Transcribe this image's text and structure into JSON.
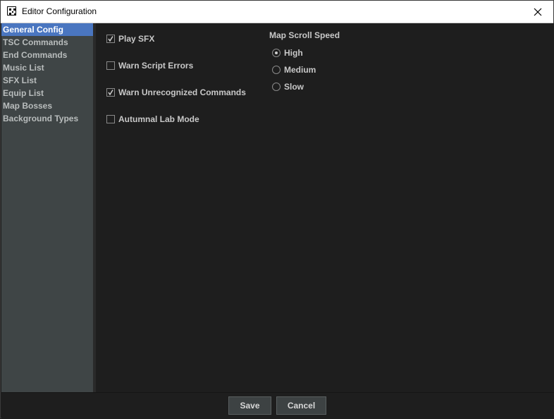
{
  "window": {
    "title": "Editor Configuration",
    "app_icon": "app-qr-icon",
    "close_icon": "close-icon"
  },
  "sidebar": {
    "items": [
      {
        "label": "General Config",
        "selected": true
      },
      {
        "label": "TSC Commands",
        "selected": false
      },
      {
        "label": "End Commands",
        "selected": false
      },
      {
        "label": "Music List",
        "selected": false
      },
      {
        "label": "SFX List",
        "selected": false
      },
      {
        "label": "Equip List",
        "selected": false
      },
      {
        "label": "Map Bosses",
        "selected": false
      },
      {
        "label": "Background Types",
        "selected": false
      }
    ]
  },
  "general": {
    "options": [
      {
        "label": "Play SFX",
        "checked": true
      },
      {
        "label": "Warn Script Errors",
        "checked": false
      },
      {
        "label": "Warn Unrecognized Commands",
        "checked": true
      },
      {
        "label": "Autumnal Lab Mode",
        "checked": false
      }
    ],
    "scroll_speed": {
      "label": "Map Scroll Speed",
      "options": [
        {
          "label": "High",
          "selected": true
        },
        {
          "label": "Medium",
          "selected": false
        },
        {
          "label": "Slow",
          "selected": false
        }
      ]
    }
  },
  "footer": {
    "save_label": "Save",
    "cancel_label": "Cancel"
  },
  "colors": {
    "accent": "#4a76c0",
    "sidebar_bg": "#3f4546",
    "content_bg": "#1e1e1e",
    "text": "#c8c8c8"
  }
}
